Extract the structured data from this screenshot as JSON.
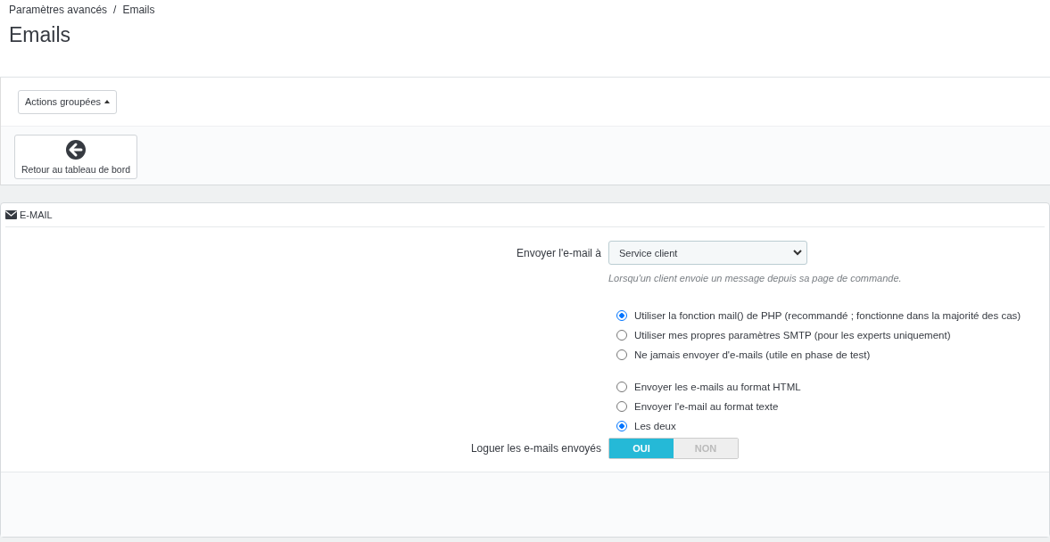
{
  "breadcrumb": [
    {
      "label": "Paramètres avancés"
    },
    {
      "label": "Emails"
    }
  ],
  "breadcrumb_separator": "/",
  "page_title": "Emails",
  "bulk_actions": {
    "label": "Actions groupées"
  },
  "back_button": {
    "label": "Retour au tableau de bord"
  },
  "panel": {
    "title": "E-MAIL",
    "send_to": {
      "label": "Envoyer l'e-mail à",
      "value": "Service client",
      "help": "Lorsqu'un client envoie un message depuis sa page de commande."
    },
    "radio_groups": [
      [
        {
          "label": "Utiliser la fonction mail() de PHP (recommandé ; fonctionne dans la majorité des cas)",
          "selected": true
        },
        {
          "label": "Utiliser mes propres paramètres SMTP (pour les experts uniquement)",
          "selected": false
        },
        {
          "label": "Ne jamais envoyer d'e-mails (utile en phase de test)",
          "selected": false
        }
      ],
      [
        {
          "label": "Envoyer les e-mails au format HTML",
          "selected": false
        },
        {
          "label": "Envoyer l'e-mail au format texte",
          "selected": false
        },
        {
          "label": "Les deux",
          "selected": true
        }
      ]
    ],
    "log_emails": {
      "label": "Loguer les e-mails envoyés",
      "options": [
        {
          "label": "OUI",
          "selected": true
        },
        {
          "label": "NON",
          "selected": false
        }
      ]
    }
  }
}
